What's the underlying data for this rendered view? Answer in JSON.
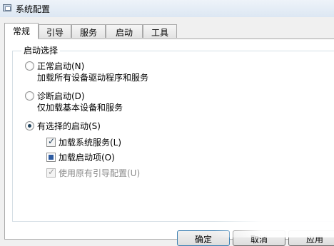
{
  "window": {
    "title": "系统配置"
  },
  "tabs": [
    {
      "label": "常规",
      "active": true
    },
    {
      "label": "引导",
      "active": false
    },
    {
      "label": "服务",
      "active": false
    },
    {
      "label": "启动",
      "active": false
    },
    {
      "label": "工具",
      "active": false
    }
  ],
  "startup": {
    "group_label": "启动选择",
    "normal": {
      "label": "正常启动(N)",
      "desc": "加载所有设备驱动程序和服务",
      "selected": false
    },
    "diagnostic": {
      "label": "诊断启动(D)",
      "desc": "仅加载基本设备和服务",
      "selected": false
    },
    "selective": {
      "label": "有选择的启动(S)",
      "selected": true,
      "options": [
        {
          "label": "加载系统服务(L)",
          "state": "checked"
        },
        {
          "label": "加载启动项(O)",
          "state": "indeterminate"
        },
        {
          "label": "使用原有引导配置(U)",
          "state": "checked-disabled"
        }
      ]
    }
  },
  "buttons": {
    "ok": "确定",
    "cancel": "取消",
    "apply": "应用"
  }
}
